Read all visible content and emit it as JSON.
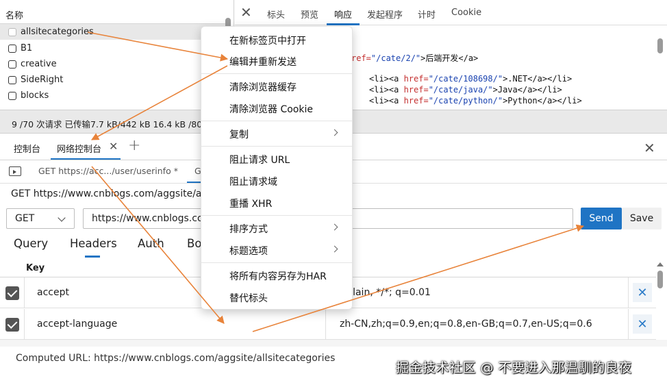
{
  "request_list": {
    "header": "名称",
    "items": [
      "allsitecategories",
      "B1",
      "creative",
      "SideRight",
      "blocks"
    ]
  },
  "detail": {
    "tabs": [
      "标头",
      "预览",
      "响应",
      "发起程序",
      "计时",
      "Cookie"
    ],
    "active_tab": "响应",
    "code": {
      "l1_a": "ref=",
      "l1_b": "\"/cate/2/\"",
      "l1_c": ">后端开发</a>",
      "l2_a": "<li><a ",
      "l2_b": "href=",
      "l2_c": "\"/cate/108698/\"",
      "l2_d": ">.NET</a></li>",
      "l3_a": "<li><a ",
      "l3_b": "href=",
      "l3_c": "\"/cate/java/\"",
      "l3_d": ">Java</a></li>",
      "l4_a": "<li><a ",
      "l4_b": "href=",
      "l4_c": "\"/cate/python/\"",
      "l4_d": ">Python</a></li>"
    }
  },
  "status_bar": {
    "text": "9 /70 次请求  已传输7.7 kB/442 kB  16.4 kB /801"
  },
  "console_tabs": {
    "console": "控制台",
    "network_console": "网络控制台",
    "add": "+"
  },
  "request_tabs": {
    "tab1": "GET https://acc.../user/userinfo *",
    "tab2": "G"
  },
  "request": {
    "url_line": "GET https://www.cnblogs.com/aggsite/al",
    "method": "GET",
    "url_value": "https://www.cnblogs.co",
    "send_label": "Send",
    "save_label": "Save"
  },
  "sections": {
    "tabs": [
      "Query",
      "Headers",
      "Auth",
      "Bo"
    ],
    "active": "Headers"
  },
  "headers_table": {
    "key_label": "Key",
    "rows": [
      {
        "key": "accept",
        "value": "t/plain, */*; q=0.01"
      },
      {
        "key": "accept-language",
        "value": "zh-CN,zh;q=0.9,en;q=0.8,en-GB;q=0.7,en-US;q=0.6"
      }
    ]
  },
  "computed_url": "Computed URL: https://www.cnblogs.com/aggsite/allsitecategories",
  "watermark": "掘金技术社区 @ 不要进入那温馴的良夜",
  "context_menu": {
    "items": [
      "在新标签页中打开",
      "编辑并重新发送",
      "清除浏览器缓存",
      "清除浏览器 Cookie",
      "复制",
      "阻止请求 URL",
      "阻止请求域",
      "重播 XHR",
      "排序方式",
      "标题选项",
      "将所有内容另存为HAR",
      "替代标头"
    ]
  },
  "colors": {
    "accent": "#1f74c4",
    "arrow": "#e8833a"
  }
}
